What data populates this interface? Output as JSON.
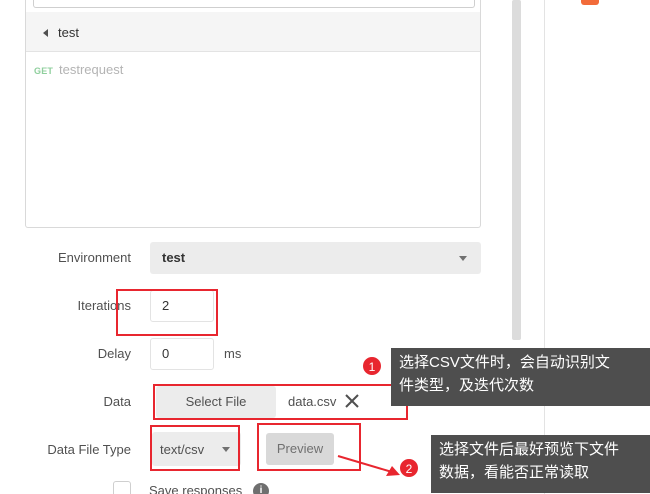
{
  "collection": {
    "name": "test",
    "request": {
      "method": "GET",
      "name": "testrequest"
    }
  },
  "form": {
    "environment": {
      "label": "Environment",
      "value": "test"
    },
    "iterations": {
      "label": "Iterations",
      "value": "2"
    },
    "delay": {
      "label": "Delay",
      "value": "0",
      "unit": "ms"
    },
    "data": {
      "label": "Data",
      "button": "Select File",
      "file_name": "data.csv"
    },
    "data_file_type": {
      "label": "Data File Type",
      "value": "text/csv",
      "preview_button": "Preview"
    },
    "save_responses": {
      "label": "Save responses",
      "info": "i"
    }
  },
  "annotations": {
    "callout_1": {
      "number": "1",
      "text_line1": "选择CSV文件时，会自动识别文",
      "text_line2": "件类型，及迭代次数"
    },
    "callout_2": {
      "number": "2",
      "text_line1": "选择文件后最好预览下文件",
      "text_line2": "数据，看能否正常读取"
    }
  },
  "colors": {
    "accent_orange": "#f26b3a",
    "annotation_red": "#e8262f",
    "callout_bg": "#4e4e4e",
    "get_method_green": "#8fcf9d"
  }
}
